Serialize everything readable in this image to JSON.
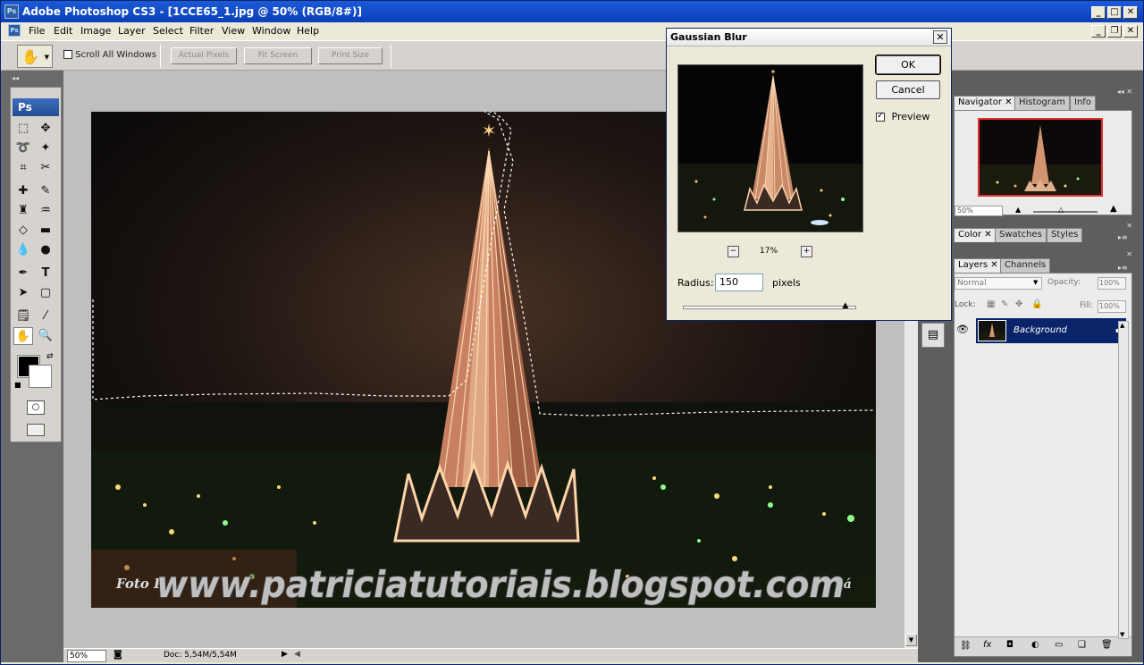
{
  "window": {
    "title": "Adobe Photoshop CS3 - [1CCE65_1.jpg @ 50% (RGB/8#)]"
  },
  "menu": [
    "File",
    "Edit",
    "Image",
    "Layer",
    "Select",
    "Filter",
    "View",
    "Window",
    "Help"
  ],
  "options": {
    "scroll_all": "Scroll All Windows",
    "actual_pixels": "Actual Pixels",
    "fit_screen": "Fit Screen",
    "print_size": "Print Size"
  },
  "toolbox": {
    "logo": "Ps"
  },
  "canvas": {
    "watermark": "www.patriciatutoriais.blogspot.com",
    "credit": "Foto P",
    "credit_tail": "gá"
  },
  "status": {
    "zoom": "50%",
    "doc": "Doc: 5,54M/5,54M"
  },
  "navigator": {
    "tabs": [
      "Navigator",
      "Histogram",
      "Info"
    ],
    "zoom": "50%"
  },
  "color_panel": {
    "tabs": [
      "Color",
      "Swatches",
      "Styles"
    ]
  },
  "layers_panel": {
    "tabs": [
      "Layers",
      "Channels"
    ],
    "blend_mode": "Normal",
    "opacity_label": "Opacity:",
    "opacity": "100%",
    "lock_label": "Lock:",
    "fill_label": "Fill:",
    "fill": "100%",
    "layer_name": "Background"
  },
  "dialog": {
    "title": "Gaussian Blur",
    "ok": "OK",
    "cancel": "Cancel",
    "preview_label": "Preview",
    "preview_checked": true,
    "zoom": "17%",
    "radius_label": "Radius:",
    "radius": "150",
    "units": "pixels",
    "radius_level": 0.94
  }
}
